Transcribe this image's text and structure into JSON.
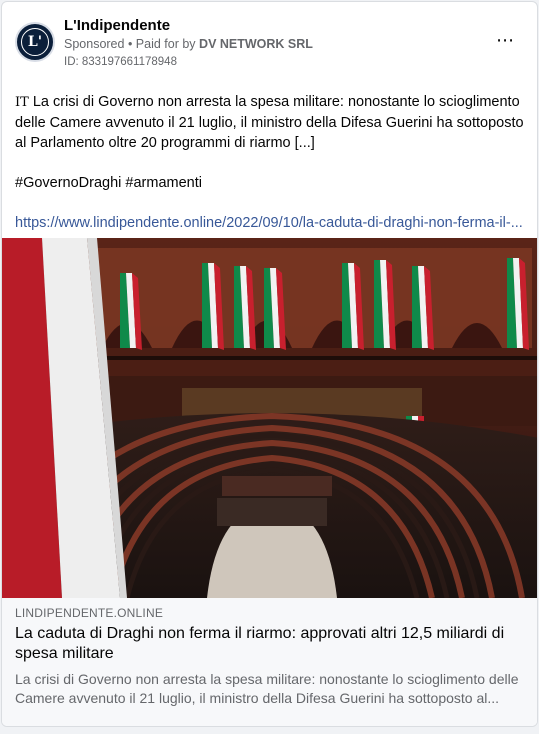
{
  "post": {
    "page_name": "L'Indipendente",
    "avatar_letter": "L'",
    "sponsored_label": "Sponsored",
    "paid_prefix": "• Paid for by",
    "paid_by": "DV NETWORK SRL",
    "ad_id": "ID: 833197661178948",
    "more_icon": "⋯"
  },
  "content": {
    "lang_tag": "IT",
    "paragraph": "La crisi di Governo non arresta la spesa militare: nonostante lo scioglimento delle Camere avvenuto il 21 luglio, il ministro della Difesa Guerini ha sottoposto al Parlamento oltre 20 programmi di riarmo [...]",
    "hashtags": "#GovernoDraghi #armamenti",
    "url": "https://www.lindipendente.online/2022/09/10/la-caduta-di-draghi-non-ferma-il-..."
  },
  "link_preview": {
    "domain": "LINDIPENDENTE.ONLINE",
    "headline": "La caduta di Draghi non ferma il riarmo: approvati altri 12,5 miliardi di spesa militare",
    "description": "La crisi di Governo non arresta la spesa militare: nonostante lo scioglimento delle Camere avvenuto il 21 luglio, il ministro della Difesa Guerini ha sottoposto al..."
  },
  "colors": {
    "link": "#385898",
    "muted": "#65676b",
    "flag_green": "#0f8a4a",
    "flag_white": "#f2f2f2",
    "flag_red": "#c8202e"
  }
}
